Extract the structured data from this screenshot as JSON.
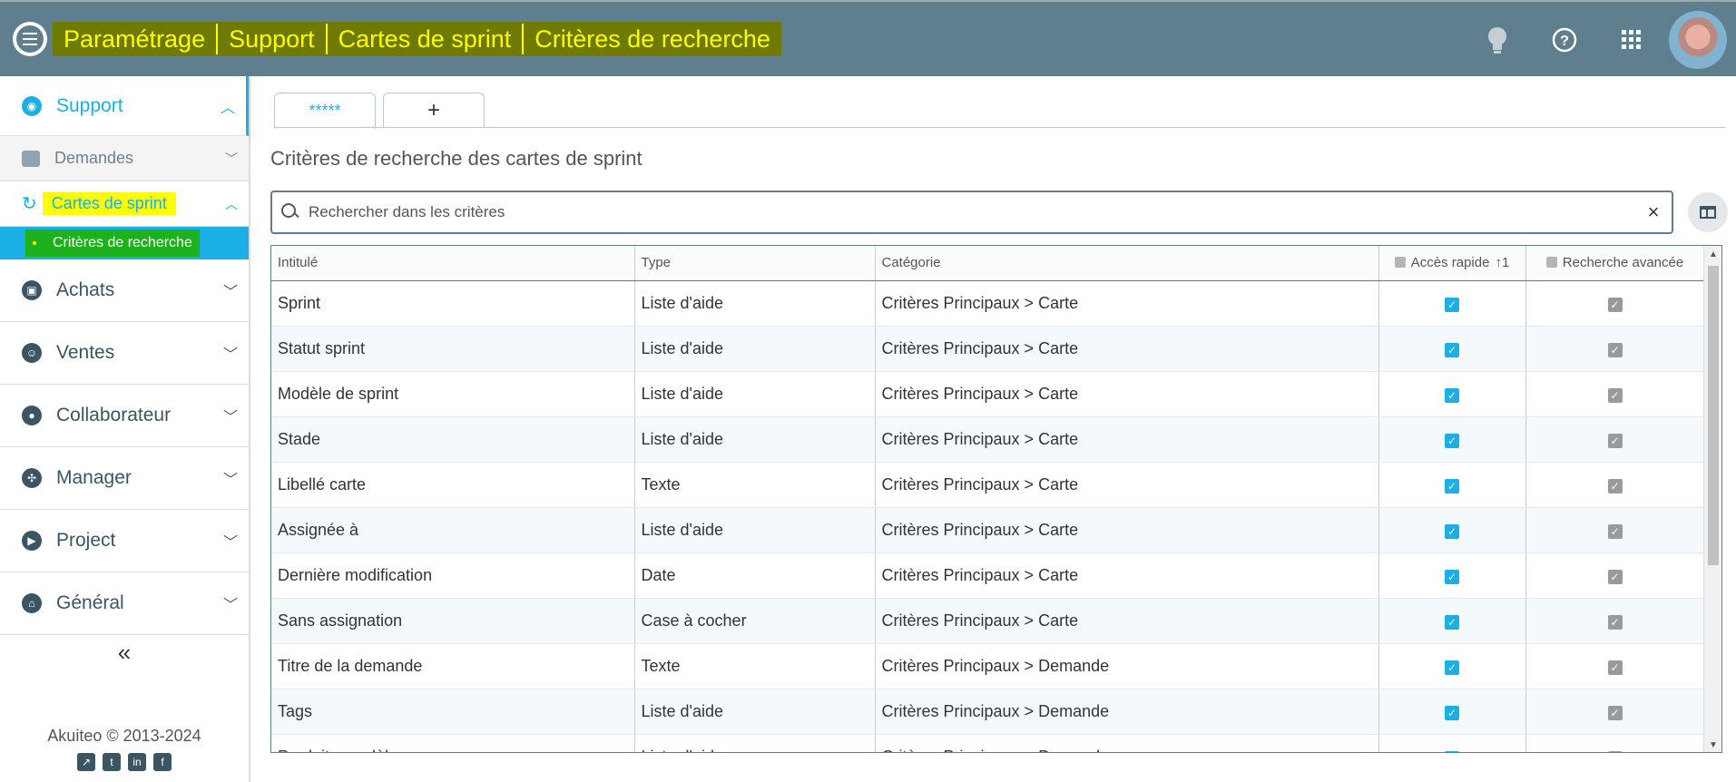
{
  "breadcrumbs": [
    "Paramétrage",
    "Support",
    "Cartes de sprint",
    "Critères de recherche"
  ],
  "header_icons": [
    "lightbulb-icon",
    "help-icon",
    "apps-grid-icon",
    "user-avatar"
  ],
  "sidebar": {
    "support": "Support",
    "demandes": "Demandes",
    "cartes_de_sprint": "Cartes de sprint",
    "criteres": "Critères de recherche",
    "items": [
      {
        "label": "Achats",
        "icon": "achats-icon"
      },
      {
        "label": "Ventes",
        "icon": "ventes-icon"
      },
      {
        "label": "Collaborateur",
        "icon": "collaborateur-icon"
      },
      {
        "label": "Manager",
        "icon": "manager-icon"
      },
      {
        "label": "Project",
        "icon": "project-icon"
      },
      {
        "label": "Général",
        "icon": "general-icon"
      }
    ],
    "collapse": "«",
    "footer": "Akuiteo © 2013-2024"
  },
  "tabs": {
    "active": "*****",
    "add": "+"
  },
  "page_title": "Critères de recherche des cartes de sprint",
  "search": {
    "placeholder": "Rechercher dans les critères",
    "clear": "×"
  },
  "table": {
    "headers": {
      "intitule": "Intitulé",
      "type": "Type",
      "categorie": "Catégorie",
      "acces": "Accès rapide",
      "acces_sort": "1",
      "recherche": "Recherche avancée"
    },
    "rows": [
      {
        "intitule": "Sprint",
        "type": "Liste d'aide",
        "categorie": "Critères Principaux > Carte"
      },
      {
        "intitule": "Statut sprint",
        "type": "Liste d'aide",
        "categorie": "Critères Principaux > Carte"
      },
      {
        "intitule": "Modèle de sprint",
        "type": "Liste d'aide",
        "categorie": "Critères Principaux > Carte"
      },
      {
        "intitule": "Stade",
        "type": "Liste d'aide",
        "categorie": "Critères Principaux > Carte"
      },
      {
        "intitule": "Libellé carte",
        "type": "Texte",
        "categorie": "Critères Principaux > Carte"
      },
      {
        "intitule": "Assignée à",
        "type": "Liste d'aide",
        "categorie": "Critères Principaux > Carte"
      },
      {
        "intitule": "Dernière modification",
        "type": "Date",
        "categorie": "Critères Principaux > Carte"
      },
      {
        "intitule": "Sans assignation",
        "type": "Case à cocher",
        "categorie": "Critères Principaux > Carte"
      },
      {
        "intitule": "Titre de la demande",
        "type": "Texte",
        "categorie": "Critères Principaux > Demande"
      },
      {
        "intitule": "Tags",
        "type": "Liste d'aide",
        "categorie": "Critères Principaux > Demande"
      },
      {
        "intitule": "Produit - modèle",
        "type": "Liste d'aide",
        "categorie": "Critères Principaux > Demande"
      }
    ]
  },
  "colors": {
    "header": "#5f7e8e",
    "accent": "#1cafe6",
    "highlight": "#ffff00",
    "selected_green": "#1db21d"
  }
}
